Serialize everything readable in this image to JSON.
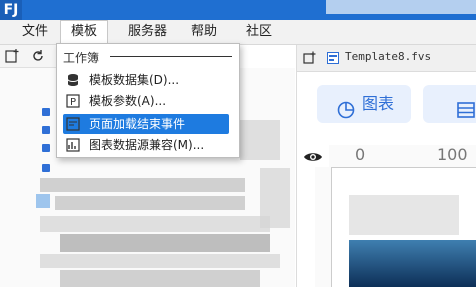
{
  "app": {
    "logo": "FJ"
  },
  "menubar": {
    "items": [
      {
        "label": "文件"
      },
      {
        "label": "模板"
      },
      {
        "label": "服务器"
      },
      {
        "label": "帮助"
      },
      {
        "label": "社区"
      }
    ]
  },
  "dropdown": {
    "header": "工作簿",
    "items": [
      {
        "label": "模板数据集(D)...",
        "icon": "database-icon"
      },
      {
        "label": "模板参数(A)...",
        "icon": "parameter-icon"
      },
      {
        "label": "页面加载结束事件",
        "icon": "event-icon",
        "highlighted": true
      },
      {
        "label": "图表数据源兼容(M)...",
        "icon": "chart-data-icon"
      }
    ]
  },
  "right_panel": {
    "tab_label": "Template8.fvs",
    "buttons": [
      {
        "label": "图表",
        "icon": "chart-icon"
      },
      {
        "label": "",
        "icon": "table-icon"
      }
    ],
    "ruler_label": "100",
    "ruler_start": "0"
  },
  "colors": {
    "accent": "#1e7be0",
    "titlebar": "#1f6fd1",
    "button_bg": "#e8f0fd"
  }
}
